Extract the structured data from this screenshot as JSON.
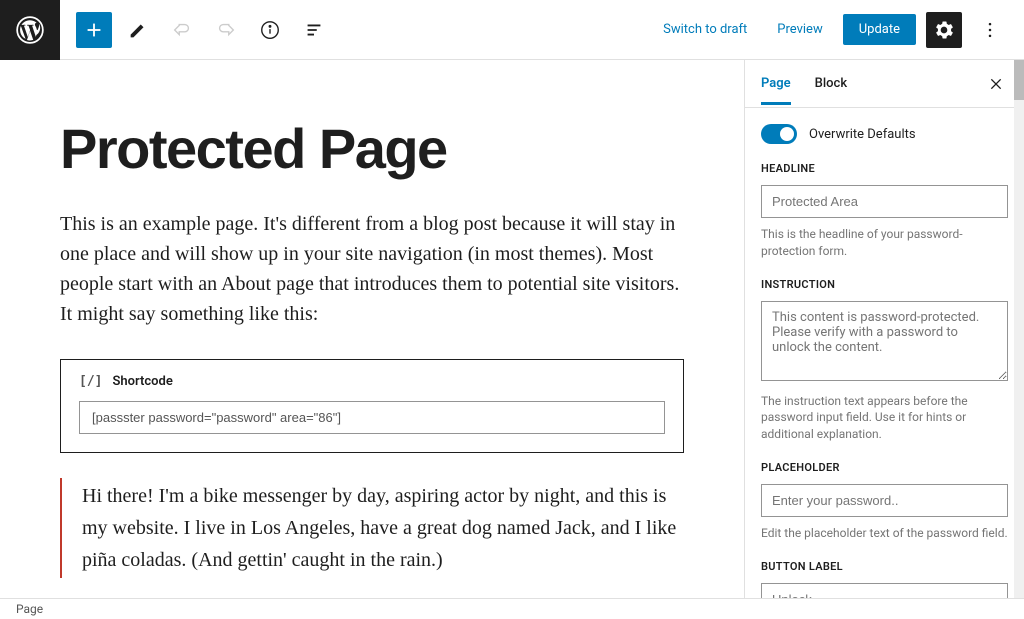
{
  "toolbar": {
    "switch_to_draft": "Switch to draft",
    "preview": "Preview",
    "update": "Update"
  },
  "editor": {
    "title": "Protected Page",
    "intro": "This is an example page. It's different from a blog post because it will stay in one place and will show up in your site navigation (in most themes). Most people start with an About page that introduces them to potential site visitors. It might say something like this:",
    "shortcode_label": "Shortcode",
    "shortcode_value": "[passster password=\"password\" area=\"86\"]",
    "quote": "Hi there! I'm a bike messenger by day, aspiring actor by night, and this is my website. I live in Los Angeles, have a great dog named Jack, and I like piña coladas. (And gettin' caught in the rain.)"
  },
  "sidebar": {
    "tabs": {
      "page": "Page",
      "block": "Block"
    },
    "overwrite_defaults": "Overwrite Defaults",
    "headline": {
      "label": "HEADLINE",
      "placeholder": "Protected Area",
      "help": "This is the headline of your password-protection form."
    },
    "instruction": {
      "label": "INSTRUCTION",
      "placeholder": "This content is password-protected. Please verify with a password to unlock the content.",
      "help": "The instruction text appears before the password input field. Use it for hints or additional explanation."
    },
    "placeholder_field": {
      "label": "PLACEHOLDER",
      "placeholder": "Enter your password..",
      "help": "Edit the placeholder text of the password field."
    },
    "button_label": {
      "label": "BUTTON LABEL",
      "placeholder": "Unlock"
    }
  },
  "status": {
    "breadcrumb": "Page"
  }
}
